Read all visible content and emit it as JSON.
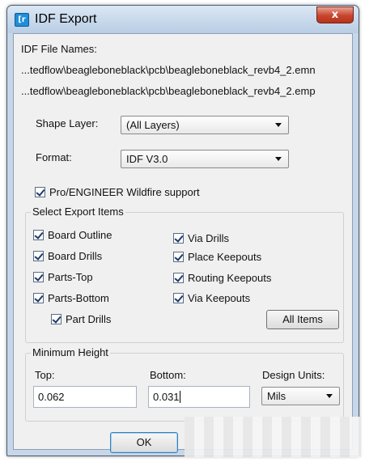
{
  "window": {
    "title": "IDF Export",
    "close_glyph": "x",
    "app_icon_glyph": "[r"
  },
  "file_names": {
    "label": "IDF File Names:",
    "emn_path": "...tedflow\\beagleboneblack\\pcb\\beagleboneblack_revb4_2.emn",
    "emp_path": "...tedflow\\beagleboneblack\\pcb\\beagleboneblack_revb4_2.emp"
  },
  "shape_layer": {
    "label": "Shape Layer:",
    "value": "(All Layers)"
  },
  "format": {
    "label": "Format:",
    "value": "IDF V3.0"
  },
  "wildfire": {
    "label": "Pro/ENGINEER Wildfire support",
    "checked": true
  },
  "export_items": {
    "title": "Select Export Items",
    "left": [
      {
        "label": "Board Outline",
        "checked": true
      },
      {
        "label": "Board Drills",
        "checked": true
      },
      {
        "label": "Parts-Top",
        "checked": true
      },
      {
        "label": "Parts-Bottom",
        "checked": true
      },
      {
        "label": "Part Drills",
        "checked": true
      }
    ],
    "right": [
      {
        "label": "Via Drills",
        "checked": true
      },
      {
        "label": "Place Keepouts",
        "checked": true
      },
      {
        "label": "Routing Keepouts",
        "checked": true
      },
      {
        "label": "Via Keepouts",
        "checked": true
      }
    ],
    "all_items_label": "All  Items"
  },
  "min_height": {
    "title": "Minimum Height",
    "top_label": "Top:",
    "top_value": "0.062",
    "bottom_label": "Bottom:",
    "bottom_value": "0.031",
    "units_label": "Design Units:",
    "units_value": "Mils"
  },
  "ok_label": "OK"
}
